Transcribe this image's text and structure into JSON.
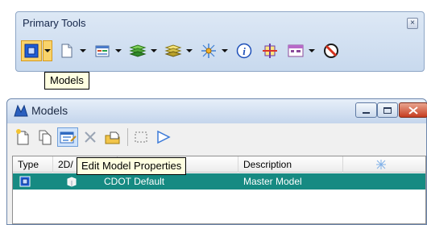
{
  "primary_tools": {
    "title": "Primary Tools",
    "close_glyph": "×",
    "tools": [
      {
        "icon": "models-icon",
        "active": true,
        "dropdown": true
      },
      {
        "icon": "new-file-icon",
        "dropdown": true
      },
      {
        "icon": "element-info-icon",
        "dropdown": true
      },
      {
        "icon": "levels-icon",
        "dropdown": true
      },
      {
        "icon": "layers-icon",
        "dropdown": true
      },
      {
        "icon": "snap-icon",
        "dropdown": true
      },
      {
        "icon": "info-icon"
      },
      {
        "icon": "accudraw-icon"
      },
      {
        "icon": "tool-settings-icon",
        "dropdown": true
      },
      {
        "icon": "no-entry-icon"
      }
    ],
    "tooltip": "Models"
  },
  "models_window": {
    "title": "Models",
    "toolbar": [
      "create-model-icon",
      "copy-model-icon",
      "edit-model-properties-icon",
      "delete-model-icon",
      "import-model-icon",
      "select-region-icon",
      "create-view-icon"
    ],
    "tooltip": "Edit Model Properties",
    "columns": {
      "type": "Type",
      "twod": "2D/",
      "description": "Description"
    },
    "rows": [
      {
        "name": "CDOT Default",
        "description": "Master Model"
      }
    ],
    "colors": {
      "selection": "#168a82",
      "highlight": "#f9d36a"
    }
  }
}
